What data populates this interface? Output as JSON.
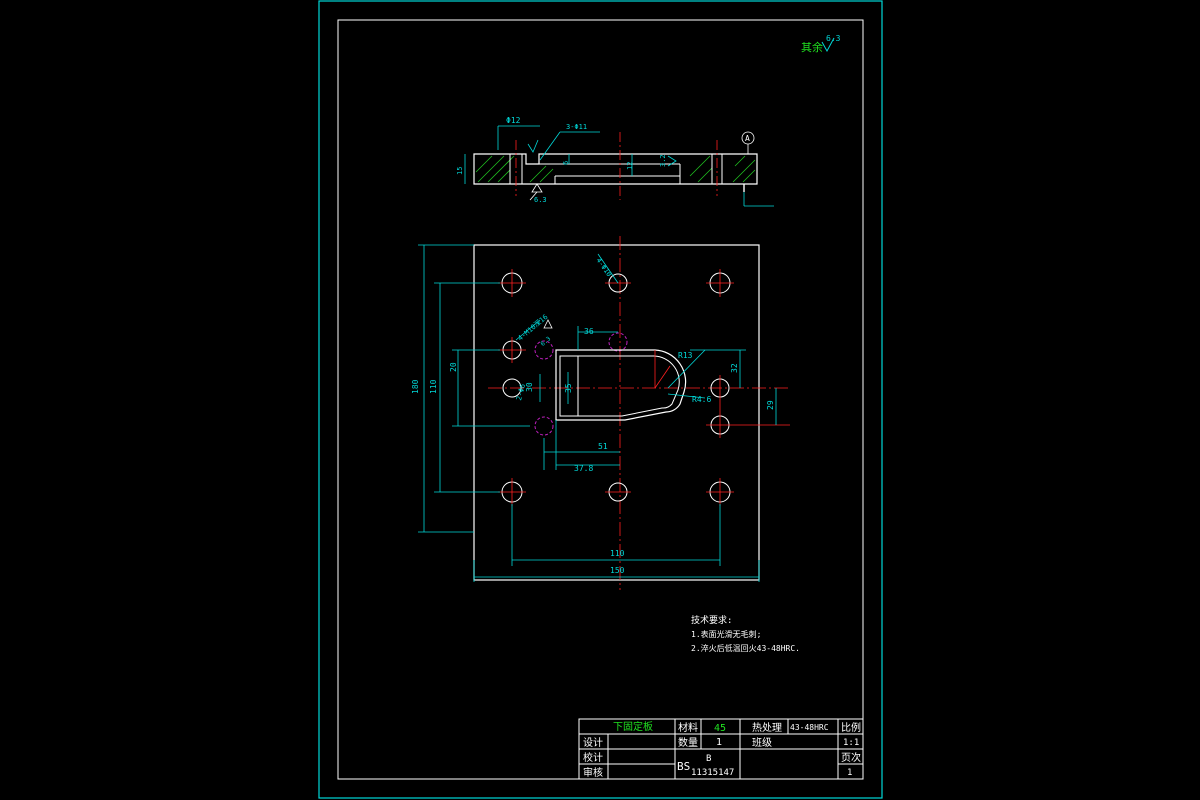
{
  "roughness": {
    "label": "其余",
    "value": "6.3"
  },
  "section_view": {
    "dims": {
      "hole_dia": "Φ12",
      "holes_spec": "3-Φ11",
      "thickness": "15",
      "counterbore_depth": "6",
      "pocket_depth": "12",
      "surface_mark": "3.2",
      "bottom_rough": "6.3",
      "datum": "A"
    }
  },
  "plan_view": {
    "dims": {
      "overall_height": "180",
      "hole_pitch_v": "110",
      "dim_20": "20",
      "dim_30": "30",
      "dim_35": "35",
      "dim_36": "36",
      "dim_32": "32",
      "dim_29": "29",
      "dim_51": "51",
      "dim_37": "37.8",
      "dim_110h": "110",
      "overall_width": "150",
      "radius_r": "R13",
      "radius_r2": "R4.6",
      "pin_holes": "4-Φ10",
      "small_holes": "2-Φ6",
      "screw_note": "4-M10深16",
      "angle": "6.3"
    }
  },
  "tech_req": {
    "title": "技术要求:",
    "items": [
      "1.表面光滑无毛刺;",
      "2.淬火后低温回火43-48HRC."
    ]
  },
  "title_block": {
    "part_name": "下固定板",
    "material_label": "材料",
    "material": "45",
    "heat_label": "热处理",
    "heat": "43-48HRC",
    "scale_label": "比例",
    "scale": "1:1",
    "qty_label": "数量",
    "qty": "1",
    "class_label": "班级",
    "design_label": "设计",
    "check_label": "校计",
    "review_label": "审核",
    "code_prefix": "BS",
    "code_b": "B",
    "code_num": "11315147",
    "sheet_label": "页次",
    "sheet": "1"
  },
  "colors": {
    "border": "#00d8d8",
    "geometry": "#ffffff",
    "dims": "#00d8d8",
    "center": "#ff2020",
    "hidden": "#c020c0",
    "hatch": "#20c020",
    "title": "#20e020"
  }
}
